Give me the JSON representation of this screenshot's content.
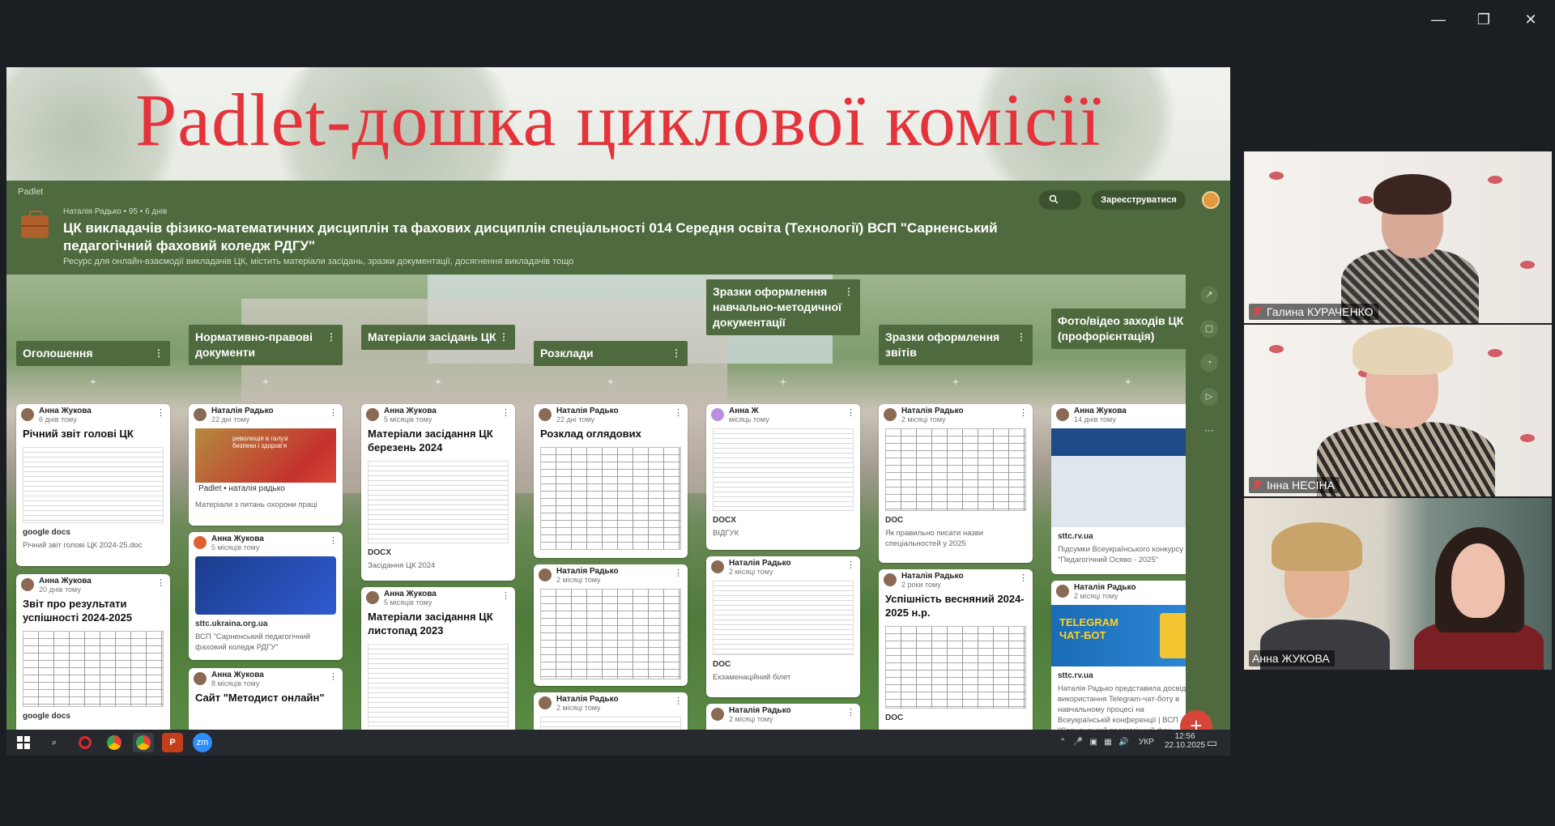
{
  "window": {
    "minimize": "—",
    "restore": "❐",
    "close": "✕"
  },
  "banner": {
    "title": "Padlet-дошка циклової комісії"
  },
  "padlet": {
    "brand": "Padlet",
    "meta": "Наталія Радько • 95 • 6 днів",
    "title": "ЦК викладачів фізико-математичних дисциплін та фахових дисциплін спеціальності 014 Середня освіта (Технології) ВСП \"Сарненський педагогічний фаховий коледж РДГУ\"",
    "description": "Ресурс для онлайн-взаємодії викладачів ЦК, містить матеріали засідань, зразки документації, досягнення викладачів тощо",
    "signup": "Зареєструватися",
    "search_icon": "search-icon"
  },
  "columns": [
    {
      "header": "Оголошення",
      "cards": [
        {
          "author": "Анна Жукова",
          "time": "6 днів тому",
          "title": "Річний звіт голові ЦК",
          "badge": "google docs",
          "caption": "Річний звіт голові ЦК 2024-25.doc"
        },
        {
          "author": "Анна Жукова",
          "time": "20 днів тому",
          "title": "Звіт про результати успішності 2024-2025",
          "badge": "google docs",
          "caption": ""
        }
      ]
    },
    {
      "header": "Нормативно-правові документи",
      "cards": [
        {
          "author": "Наталія Радько",
          "time": "22 дні тому",
          "title": "",
          "badge": "Padlet • наталія радько",
          "caption": "Матеріали з питань охорони праці"
        },
        {
          "author": "Анна Жукова",
          "time": "5 місяців тому",
          "title": "",
          "badge": "sttc.ukraina.org.ua",
          "caption": "ВСП \"Сарненський педагогічний фаховий коледж РДГУ\""
        },
        {
          "author": "Анна Жукова",
          "time": "8 місяців тому",
          "title": "Сайт \"Методист онлайн\"",
          "badge": "",
          "caption": ""
        }
      ]
    },
    {
      "header": "Матеріали засідань ЦК",
      "cards": [
        {
          "author": "Анна Жукова",
          "time": "5 місяців тому",
          "title": "Матеріали засідання ЦК березень 2024",
          "badge": "DOCX",
          "caption": "Засідання ЦК 2024"
        },
        {
          "author": "Анна Жукова",
          "time": "5 місяців тому",
          "title": "Матеріали засідання ЦК листопад 2023",
          "badge": "",
          "caption": ""
        }
      ]
    },
    {
      "header": "Розклади",
      "cards": [
        {
          "author": "Наталія Радько",
          "time": "22 дні тому",
          "title": "Розклад оглядових",
          "badge": "",
          "caption": ""
        },
        {
          "author": "Наталія Радько",
          "time": "2 місяці тому",
          "title": "",
          "badge": "",
          "caption": ""
        },
        {
          "author": "Наталія Радько",
          "time": "2 місяці тому",
          "title": "",
          "badge": "",
          "caption": ""
        }
      ]
    },
    {
      "header": "Зразки оформлення навчально-методичної документації",
      "cards": [
        {
          "author": "Анна Ж",
          "time": "місяць тому",
          "title": "",
          "badge": "DOCX",
          "caption": "ВІДГУК"
        },
        {
          "author": "Наталія Радько",
          "time": "2 місяці тому",
          "title": "",
          "badge": "DOC",
          "caption": "Екзаменаційний білет"
        },
        {
          "author": "Наталія Радько",
          "time": "2 місяці тому",
          "title": "",
          "badge": "",
          "caption": ""
        }
      ]
    },
    {
      "header": "Зразки оформлення звітів",
      "cards": [
        {
          "author": "Наталія Радько",
          "time": "2 місяці тому",
          "title": "",
          "badge": "DOC",
          "caption": "Як правильно писати назви спеціальностей у 2025"
        },
        {
          "author": "Наталія Радько",
          "time": "2 роки тому",
          "title": "Успішність весняний 2024-2025 н.р.",
          "badge": "DOC",
          "caption": ""
        }
      ]
    },
    {
      "header": "Фото/відео заходів ЦК (профорієнтація)",
      "cards": [
        {
          "author": "Анна Жукова",
          "time": "14 днів тому",
          "title": "",
          "badge": "sttc.rv.ua",
          "caption": "Підсумки Всеукраїнського конкурсу \"Педагогічний Осяво - 2025\""
        },
        {
          "author": "Наталія Радько",
          "time": "2 місяці тому",
          "title": "",
          "badge": "sttc.rv.ua",
          "caption": "Наталія Радько представила досвід використання Telegram-чат-боту в навчальному процесі на Всеукраїнській конференції | ВСП \"Сарненський педагогічний фах..."
        }
      ]
    }
  ],
  "thumbs": {
    "telegram": "TELEGRAM ЧАТ-БОТ",
    "heart": "революція в галузі безпеки і здоров'я"
  },
  "taskbar": {
    "lang": "УКР",
    "time": "12:56",
    "date": "22.10.2025",
    "apps": [
      "windows-start",
      "search",
      "opera",
      "chrome",
      "chrome",
      "powerpoint",
      "zoom"
    ],
    "zoom_label": "zm",
    "ppt_label": "P"
  },
  "participants": [
    {
      "name": "Галина КУРАЧЕНКО",
      "muted": true
    },
    {
      "name": "Інна НЕСІНА",
      "muted": true
    },
    {
      "name": "Анна ЖУКОВА",
      "muted": false,
      "speaking": true
    }
  ],
  "fab": "+",
  "colors": {
    "accent": "#4f6a3f",
    "banner_title": "#e4333a",
    "speaking": "#2ecc71",
    "fab": "#d6453a"
  }
}
